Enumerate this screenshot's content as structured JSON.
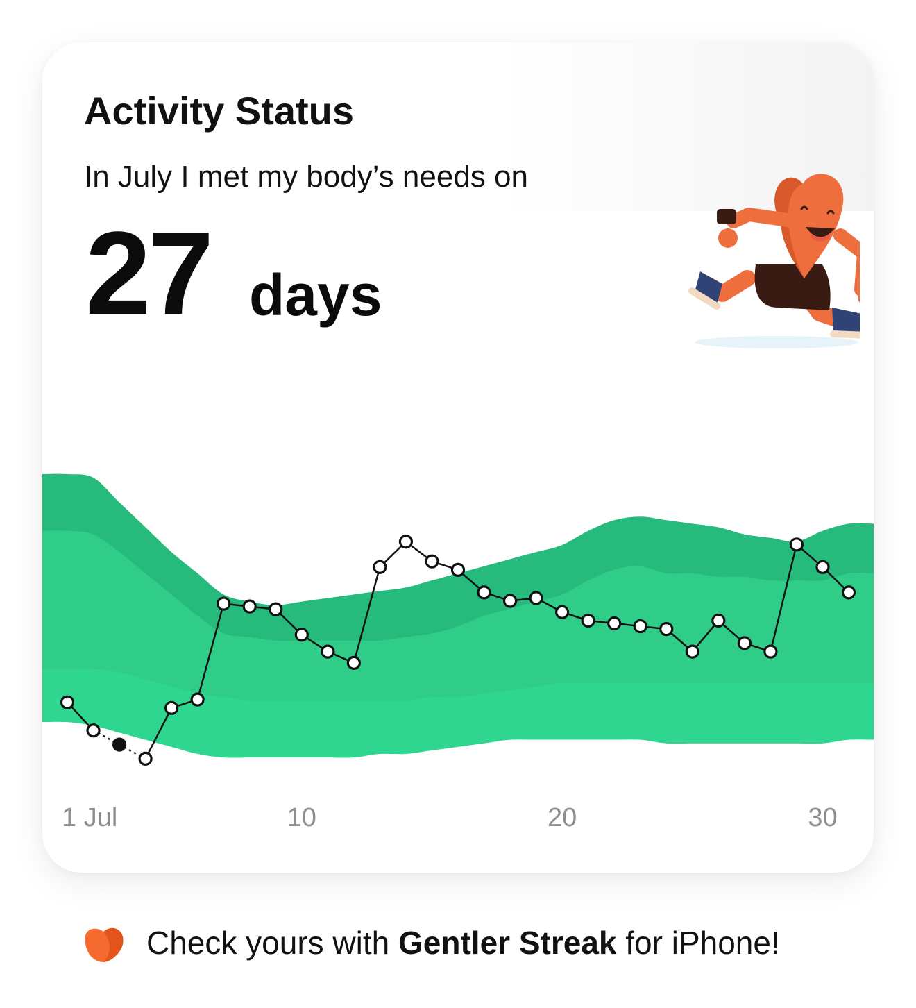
{
  "card": {
    "title": "Activity Status",
    "subtitle": "In July I met my body’s needs on",
    "count": "27",
    "unit": "days"
  },
  "mascot": {
    "icon": "running-heart-mascot-icon"
  },
  "chart_data": {
    "type": "line",
    "x_ticks": [
      "1 Jul",
      "10",
      "20",
      "30"
    ],
    "x_tick_days": [
      1,
      10,
      20,
      30
    ],
    "xlim": [
      1,
      31
    ],
    "ylim": [
      0,
      100
    ],
    "days": [
      1,
      2,
      3,
      4,
      5,
      6,
      7,
      8,
      9,
      10,
      11,
      12,
      13,
      14,
      15,
      16,
      17,
      18,
      19,
      20,
      21,
      22,
      23,
      24,
      25,
      26,
      27,
      28,
      29,
      30,
      31
    ],
    "values": [
      22,
      12,
      7,
      2,
      20,
      23,
      57,
      56,
      55,
      46,
      40,
      36,
      70,
      79,
      72,
      69,
      61,
      58,
      59,
      54,
      51,
      50,
      49,
      48,
      40,
      51,
      43,
      40,
      78,
      70,
      61
    ],
    "dotted_segments": [
      [
        2,
        3
      ],
      [
        3,
        4
      ]
    ],
    "filled_days": [
      3
    ],
    "bands": {
      "outer_top": [
        80,
        79,
        72,
        65,
        58,
        52,
        46,
        44,
        43,
        44,
        45,
        46,
        47,
        48,
        50,
        52,
        54,
        56,
        58,
        60,
        64,
        67,
        68,
        67,
        66,
        65,
        63,
        62,
        61,
        64,
        66
      ],
      "inner_top": [
        64,
        63,
        58,
        52,
        46,
        40,
        35,
        34,
        33,
        33,
        33,
        33,
        33,
        34,
        35,
        37,
        40,
        42,
        44,
        46,
        50,
        53,
        54,
        52,
        52,
        51,
        51,
        50,
        50,
        50,
        52
      ],
      "inner_bottom": [
        25,
        25,
        24,
        22,
        20,
        18,
        17,
        16,
        16,
        16,
        16,
        16,
        16,
        16,
        17,
        17,
        18,
        19,
        20,
        21,
        21,
        21,
        21,
        21,
        21,
        21,
        21,
        21,
        21,
        21,
        21
      ],
      "outer_bottom": [
        10,
        9,
        7,
        5,
        3,
        1,
        0,
        0,
        0,
        0,
        0,
        0,
        1,
        1,
        2,
        3,
        4,
        5,
        5,
        5,
        5,
        5,
        5,
        4,
        4,
        4,
        4,
        4,
        4,
        4,
        5
      ]
    },
    "colors": {
      "outer_band": "#26bb7c",
      "inner_band": "#2fcd88",
      "lower_band": "#2fd690",
      "line": "#111111"
    }
  },
  "footer": {
    "logo_icon": "gentler-streak-logo-icon",
    "text_before": "Check yours with ",
    "brand": "Gentler Streak",
    "text_after": " for iPhone!"
  }
}
